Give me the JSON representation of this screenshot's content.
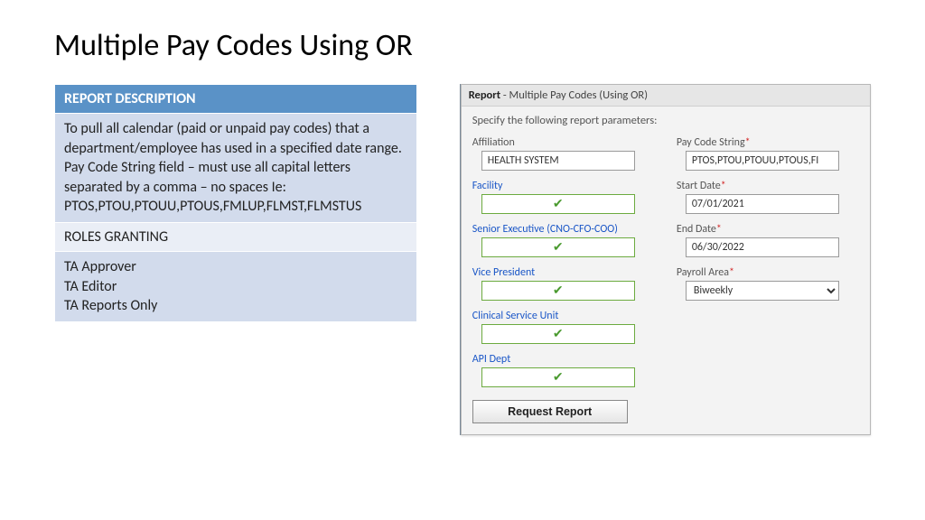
{
  "title": "Multiple Pay Codes Using OR",
  "info": {
    "desc_hdr": "REPORT DESCRIPTION",
    "desc_body": "To pull all calendar (paid or unpaid pay codes) that a department/employee has used in a specified date range. Pay Code String field – must use all capital letters separated by a comma – no spaces Ie: PTOS,PTOU,PTOUU,PTOUS,FMLUP,FLMST,FLMSTUS",
    "roles_hdr": "ROLES GRANTING",
    "roles_body": "TA Approver\n TA Editor\n TA Reports Only"
  },
  "panel": {
    "title_bold": "Report",
    "title_rest": " - Multiple Pay Codes (Using OR)",
    "instr": "Specify the following report parameters:",
    "labels": {
      "affiliation": "Affiliation",
      "paycode": "Pay Code String",
      "facility": "Facility",
      "startdate": "Start Date",
      "senior": "Senior Executive (CNO-CFO-COO)",
      "enddate": "End Date",
      "vp": "Vice President",
      "payroll": "Payroll Area",
      "csu": "Clinical Service Unit",
      "api": "API Dept"
    },
    "values": {
      "affiliation": "HEALTH SYSTEM",
      "paycode": "PTOS,PTOU,PTOUU,PTOUS,FI",
      "startdate": "07/01/2021",
      "enddate": "06/30/2022",
      "payroll": "Biweekly"
    },
    "check": "✔",
    "btn": "Request Report"
  }
}
